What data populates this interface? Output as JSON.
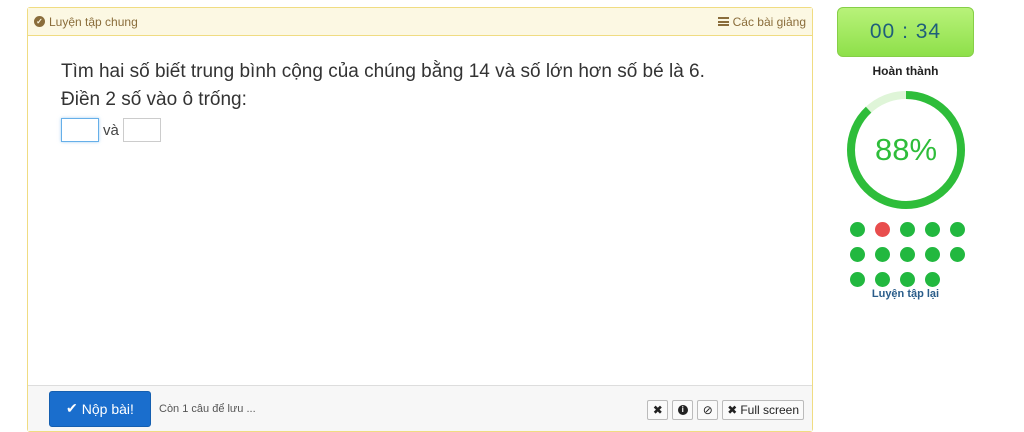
{
  "header": {
    "left_label": "Luyện tập chung",
    "right_label": "Các bài giảng"
  },
  "question": {
    "line1": "Tìm hai số biết trung bình cộng của chúng bằng 14 và số lớn hơn số bé là 6.",
    "line2": "Điền 2 số vào ô trống:",
    "connector": "và",
    "input1_value": "",
    "input2_value": ""
  },
  "footer": {
    "submit_label": "Nộp bài!",
    "remaining_text": "Còn 1 câu để lưu ...",
    "fullscreen_label": "Full screen"
  },
  "sidebar": {
    "timer": "00 : 34",
    "progress_label": "Hoàn thành",
    "progress_percent": 88,
    "progress_text": "88%",
    "retry_label": "Luyện tập lại",
    "answers": [
      "correct",
      "wrong",
      "correct",
      "correct",
      "correct",
      "correct",
      "correct",
      "correct",
      "correct",
      "correct",
      "correct",
      "correct",
      "correct",
      "correct"
    ]
  },
  "colors": {
    "accent_green": "#2ebd3a",
    "dot_correct": "#22b83f",
    "dot_wrong": "#e84d4d",
    "submit_blue": "#1a6ecd"
  }
}
